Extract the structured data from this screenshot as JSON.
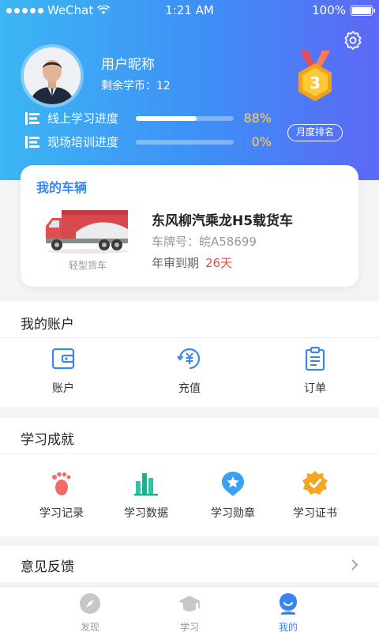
{
  "status_bar": {
    "carrier": "WeChat",
    "time": "1:21 AM",
    "battery": "100%"
  },
  "profile": {
    "nickname": "用户昵称",
    "coins": "剩余学币：12",
    "rank_button": "月度排名",
    "medal_number": "3",
    "progress": [
      {
        "label": "线上学习进度",
        "value": "88%",
        "fraction": 0.62
      },
      {
        "label": "现场培训进度",
        "value": "0%",
        "fraction": 0
      }
    ]
  },
  "vehicle": {
    "title": "我的车辆",
    "name": "东风柳汽乘龙H5载货车",
    "plate": "车牌号：皖A58699",
    "inspection_label": "年审到期",
    "inspection_days": "26天",
    "type": "轻型货车"
  },
  "account": {
    "title": "我的账户",
    "items": [
      {
        "label": "账户",
        "icon": "wallet-icon"
      },
      {
        "label": "充值",
        "icon": "recharge-icon"
      },
      {
        "label": "订单",
        "icon": "clipboard-icon"
      }
    ]
  },
  "achievements": {
    "title": "学习成就",
    "items": [
      {
        "label": "学习记录",
        "icon": "footprint-icon"
      },
      {
        "label": "学习数据",
        "icon": "bar-chart-icon"
      },
      {
        "label": "学习勋章",
        "icon": "badge-icon"
      },
      {
        "label": "学习证书",
        "icon": "certificate-icon"
      }
    ]
  },
  "feedback": {
    "label": "意见反馈"
  },
  "tabbar": {
    "items": [
      {
        "label": "发现",
        "icon": "compass-icon",
        "active": false
      },
      {
        "label": "学习",
        "icon": "graduation-cap-icon",
        "active": false
      },
      {
        "label": "我的",
        "icon": "user-icon",
        "active": true
      }
    ]
  },
  "colors": {
    "accent": "#3a86f1",
    "progress_pct": "#f7d56b",
    "warning": "#f04a3d"
  }
}
